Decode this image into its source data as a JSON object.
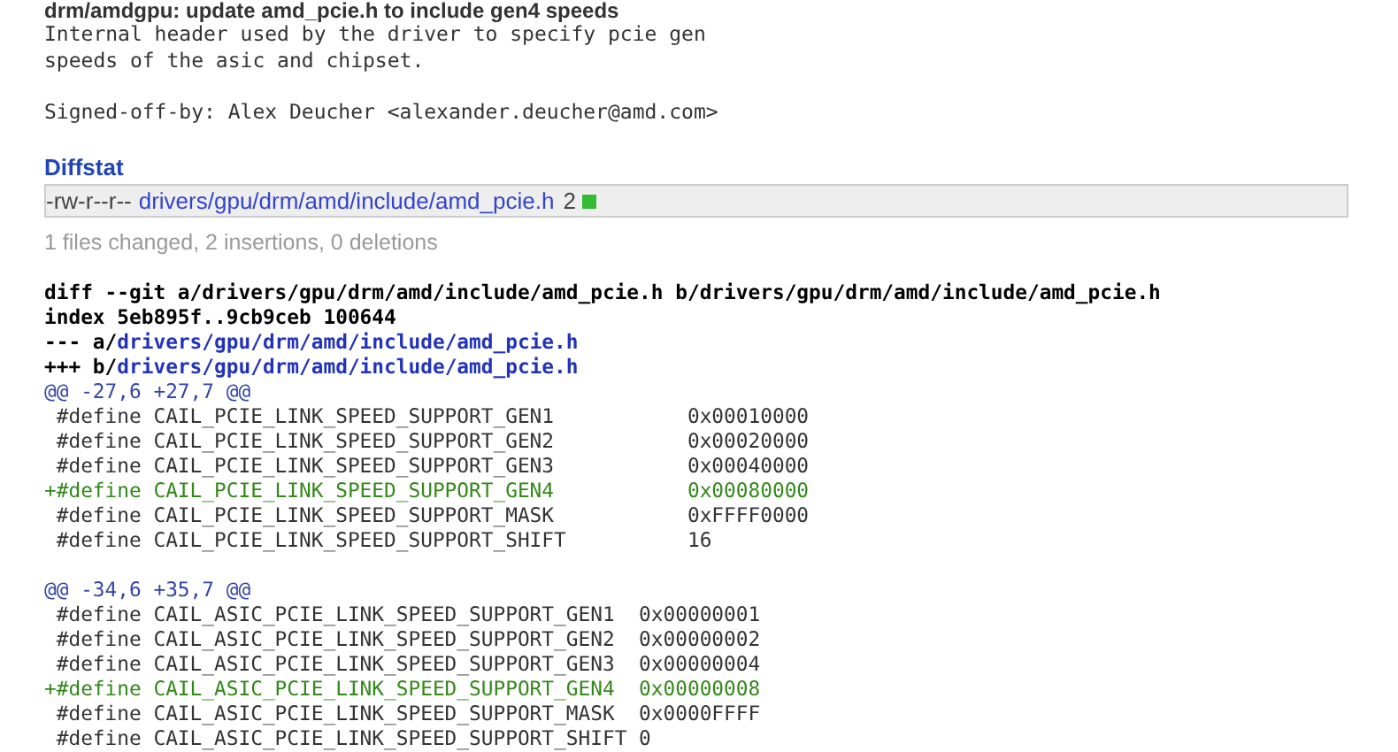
{
  "commit": {
    "title": "drm/amdgpu: update amd_pcie.h to include gen4 speeds",
    "message": [
      {
        "kind": "line",
        "text": "Internal header used by the driver to specify pcie gen"
      },
      {
        "kind": "line",
        "text": "speeds of the asic and chipset."
      },
      {
        "kind": "blank"
      },
      {
        "kind": "line",
        "text": "Signed-off-by: Alex Deucher <alexander.deucher@amd.com>"
      }
    ]
  },
  "diffstat": {
    "heading": "Diffstat",
    "files": [
      {
        "mode": "-rw-r--r--",
        "path": "drivers/gpu/drm/amd/include/amd_pcie.h",
        "count": "2"
      }
    ],
    "summary": "1 files changed, 2 insertions, 0 deletions"
  },
  "diff": [
    {
      "kind": "header",
      "text": "diff --git a/drivers/gpu/drm/amd/include/amd_pcie.h b/drivers/gpu/drm/amd/include/amd_pcie.h"
    },
    {
      "kind": "header",
      "text": "index 5eb895f..9cb9ceb 100644"
    },
    {
      "kind": "file",
      "prefix": "--- a/",
      "path": "drivers/gpu/drm/amd/include/amd_pcie.h"
    },
    {
      "kind": "file",
      "prefix": "+++ b/",
      "path": "drivers/gpu/drm/amd/include/amd_pcie.h"
    },
    {
      "kind": "hunk",
      "text": "@@ -27,6 +27,7 @@"
    },
    {
      "kind": "context",
      "text": " #define CAIL_PCIE_LINK_SPEED_SUPPORT_GEN1           0x00010000"
    },
    {
      "kind": "context",
      "text": " #define CAIL_PCIE_LINK_SPEED_SUPPORT_GEN2           0x00020000"
    },
    {
      "kind": "context",
      "text": " #define CAIL_PCIE_LINK_SPEED_SUPPORT_GEN3           0x00040000"
    },
    {
      "kind": "add",
      "text": "+#define CAIL_PCIE_LINK_SPEED_SUPPORT_GEN4           0x00080000"
    },
    {
      "kind": "context",
      "text": " #define CAIL_PCIE_LINK_SPEED_SUPPORT_MASK           0xFFFF0000"
    },
    {
      "kind": "context",
      "text": " #define CAIL_PCIE_LINK_SPEED_SUPPORT_SHIFT          16"
    },
    {
      "kind": "blank"
    },
    {
      "kind": "hunk",
      "text": "@@ -34,6 +35,7 @@"
    },
    {
      "kind": "context",
      "text": " #define CAIL_ASIC_PCIE_LINK_SPEED_SUPPORT_GEN1  0x00000001"
    },
    {
      "kind": "context",
      "text": " #define CAIL_ASIC_PCIE_LINK_SPEED_SUPPORT_GEN2  0x00000002"
    },
    {
      "kind": "context",
      "text": " #define CAIL_ASIC_PCIE_LINK_SPEED_SUPPORT_GEN3  0x00000004"
    },
    {
      "kind": "add",
      "text": "+#define CAIL_ASIC_PCIE_LINK_SPEED_SUPPORT_GEN4  0x00000008"
    },
    {
      "kind": "context",
      "text": " #define CAIL_ASIC_PCIE_LINK_SPEED_SUPPORT_MASK  0x0000FFFF"
    },
    {
      "kind": "context",
      "text": " #define CAIL_ASIC_PCIE_LINK_SPEED_SUPPORT_SHIFT 0"
    }
  ]
}
